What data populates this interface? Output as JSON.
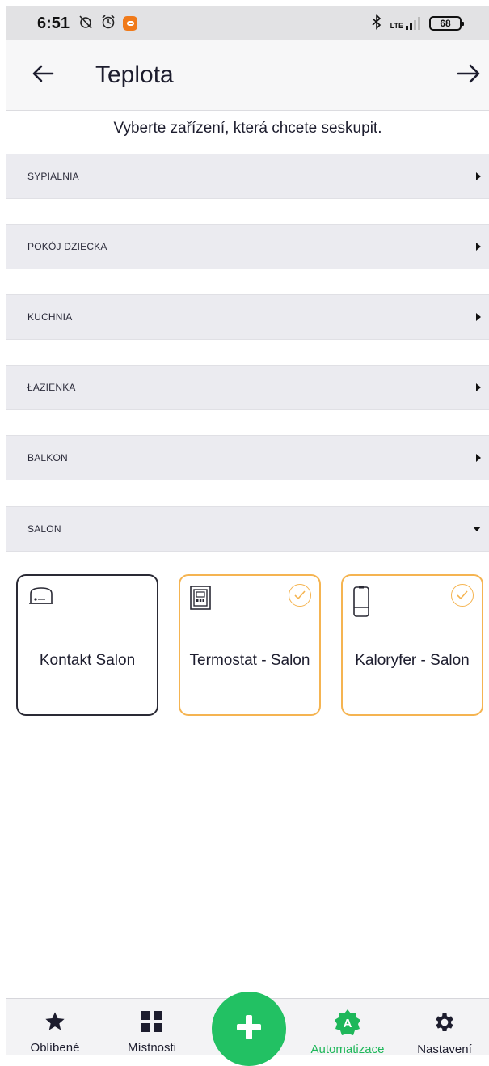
{
  "status_bar": {
    "time": "6:51",
    "battery": "68",
    "network": "LTE"
  },
  "header": {
    "title": "Teplota",
    "back_icon": "arrow-left-icon",
    "forward_icon": "arrow-right-icon"
  },
  "instruction": "Vyberte zařízení, která chcete seskupit.",
  "rooms": [
    {
      "label": "SYPIALNIA",
      "expanded": false
    },
    {
      "label": "POKÓJ DZIECKA",
      "expanded": false
    },
    {
      "label": "KUCHNIA",
      "expanded": false
    },
    {
      "label": "ŁAZIENKA",
      "expanded": false
    },
    {
      "label": "BALKON",
      "expanded": false
    },
    {
      "label": "SALON",
      "expanded": true
    }
  ],
  "devices": [
    {
      "name": "Kontakt Salon",
      "icon": "socket-icon",
      "selected": false
    },
    {
      "name": "Termostat - Salon",
      "icon": "thermostat-icon",
      "selected": true
    },
    {
      "name": "Kaloryfer - Salon",
      "icon": "radiator-icon",
      "selected": true
    }
  ],
  "bottom_nav": {
    "items": [
      {
        "label": "Oblíbené",
        "icon": "star-icon",
        "active": false
      },
      {
        "label": "Místnosti",
        "icon": "grid-icon",
        "active": false
      },
      {
        "label": "Automatizace",
        "icon": "automation-icon",
        "active": true
      },
      {
        "label": "Nastavení",
        "icon": "gear-icon",
        "active": false
      }
    ],
    "fab_icon": "plus-icon"
  },
  "colors": {
    "accent_green": "#22c163",
    "selected_border": "#f5b451",
    "row_background": "#ebebf0"
  }
}
